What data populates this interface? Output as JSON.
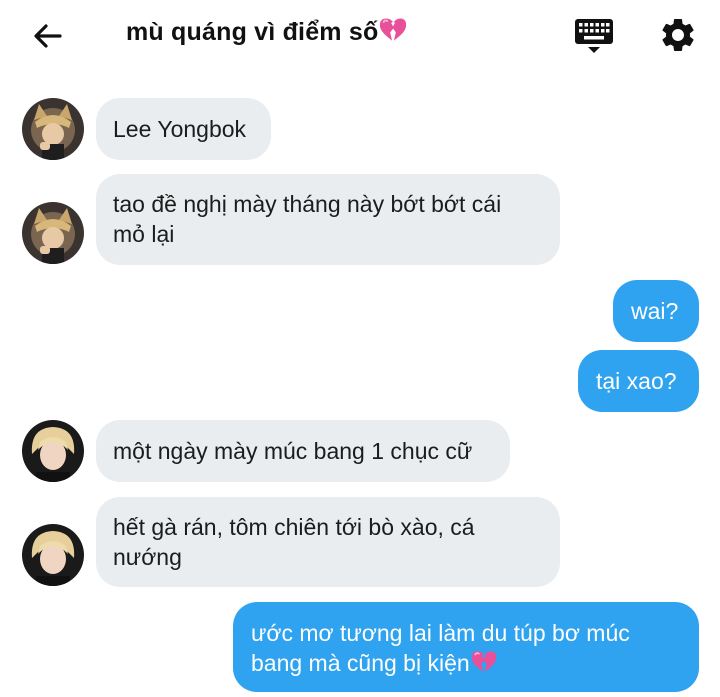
{
  "header": {
    "title": "mù quáng vì điểm số",
    "title_emoji": "broken-heart-icon",
    "icons": [
      "back-arrow-icon",
      "keyboard-icon",
      "gear-icon"
    ]
  },
  "messages": [
    {
      "from": "incoming",
      "avatar": "avatar-cat-ears",
      "lines": [
        "Lee Yongbok"
      ]
    },
    {
      "from": "incoming",
      "avatar": "avatar-cat-ears",
      "lines": [
        "tao đề nghị mày tháng này bớt bớt cái",
        "mỏ lại"
      ]
    },
    {
      "from": "outgoing",
      "lines": [
        "wai?"
      ]
    },
    {
      "from": "outgoing",
      "lines": [
        "tại xao?"
      ]
    },
    {
      "from": "incoming",
      "avatar": "avatar-blonde",
      "lines": [
        "một ngày mày múc bang 1 chục cữ"
      ]
    },
    {
      "from": "incoming",
      "avatar": "avatar-blonde",
      "lines": [
        "hết gà rán, tôm chiên tới bò xào, cá",
        "nướng"
      ]
    },
    {
      "from": "outgoing",
      "lines": [
        "ước mơ tương lai làm du túp bơ múc",
        "bang mà cũng bị kiện"
      ],
      "emoji": "broken-heart-icon"
    }
  ],
  "colors": {
    "incoming_bubble": "#e9edf0",
    "outgoing_bubble": "#2fa3f0",
    "outgoing_text": "#ffffff",
    "icon": "#111111",
    "broken_heart": "#e8509a"
  }
}
